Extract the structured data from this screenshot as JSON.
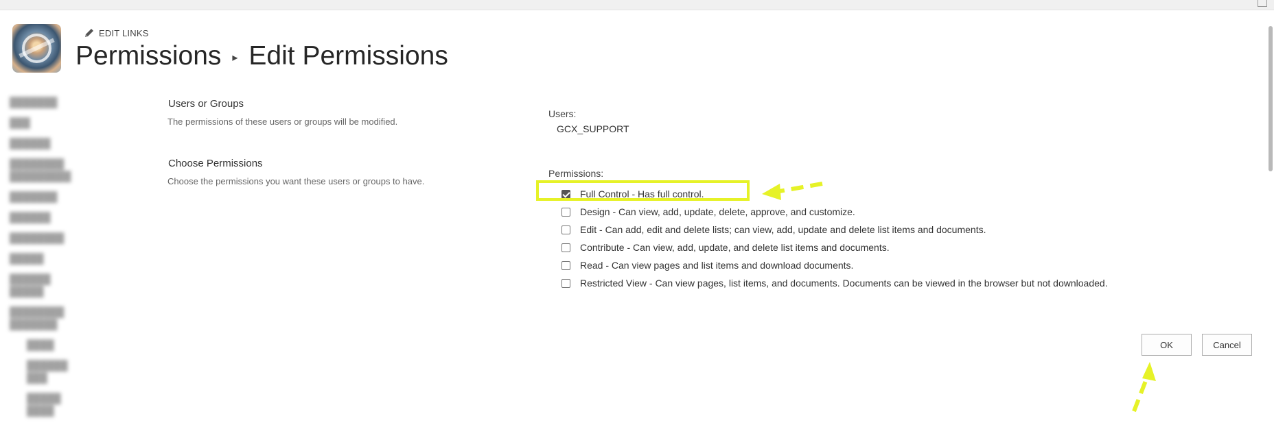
{
  "header": {
    "edit_links_label": "EDIT LINKS",
    "breadcrumb_parent": "Permissions",
    "breadcrumb_separator": "▸",
    "breadcrumb_current": "Edit Permissions"
  },
  "sections": {
    "users_groups_title": "Users or Groups",
    "users_groups_desc": "The permissions of these users or groups will be modified.",
    "choose_permissions_title": "Choose Permissions",
    "choose_permissions_desc": "Choose the permissions you want these users or groups to have."
  },
  "users": {
    "label": "Users:",
    "value": "GCX_SUPPORT"
  },
  "permissions": {
    "label": "Permissions:",
    "items": [
      {
        "label": "Full Control - Has full control.",
        "checked": true
      },
      {
        "label": "Design - Can view, add, update, delete, approve, and customize.",
        "checked": false
      },
      {
        "label": "Edit - Can add, edit and delete lists; can view, add, update and delete list items and documents.",
        "checked": false
      },
      {
        "label": "Contribute - Can view, add, update, and delete list items and documents.",
        "checked": false
      },
      {
        "label": "Read - Can view pages and list items and download documents.",
        "checked": false
      },
      {
        "label": "Restricted View - Can view pages, list items, and documents. Documents can be viewed in the browser but not downloaded.",
        "checked": false
      }
    ]
  },
  "buttons": {
    "ok": "OK",
    "cancel": "Cancel"
  },
  "annotation_color": "#e6f227",
  "icons": {
    "edit_links": "pencil-icon",
    "logo": "site-logo"
  }
}
